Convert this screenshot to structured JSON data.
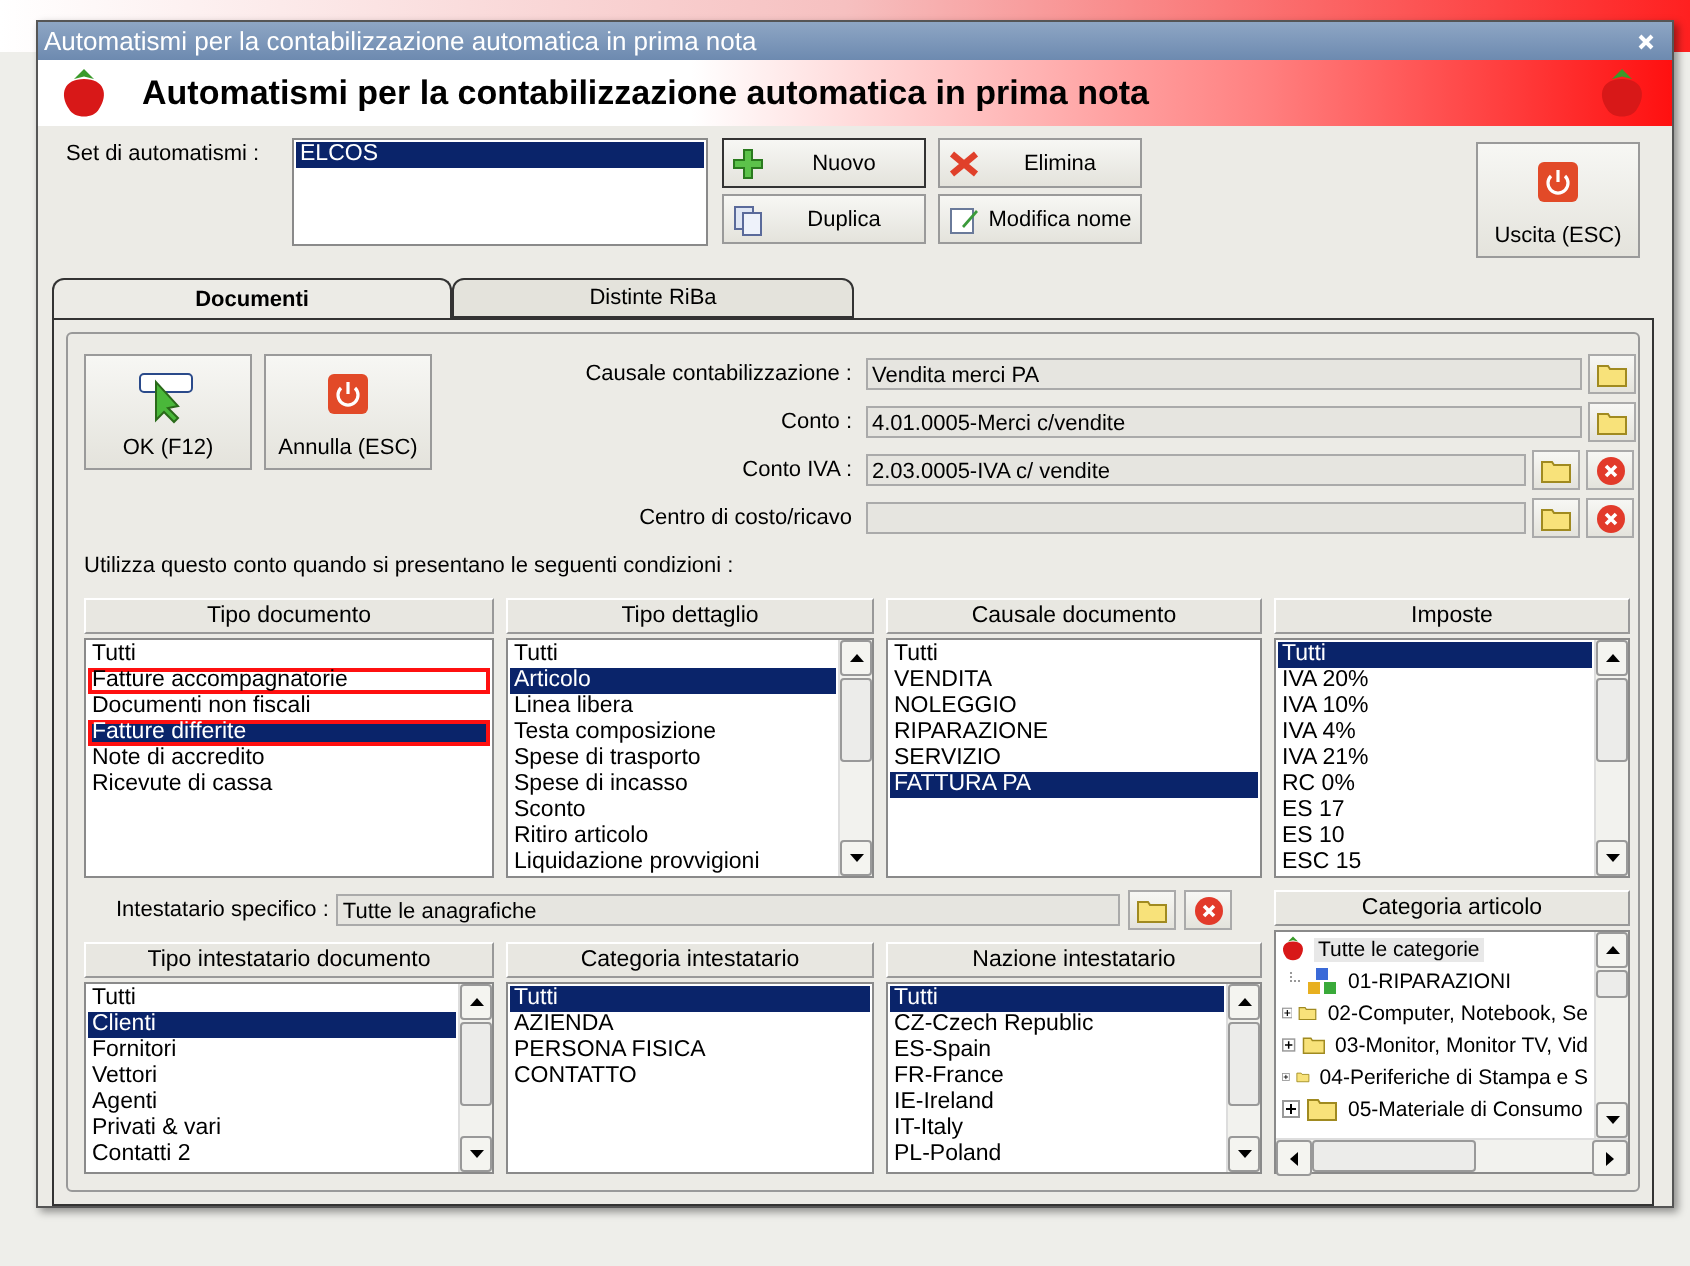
{
  "dialog": {
    "title": "Automatismi per la contabilizzazione automatica in prima nota"
  },
  "header": {
    "title": "Automatismi per la contabilizzazione automatica in prima nota"
  },
  "set": {
    "label": "Set di automatismi :",
    "items": [
      {
        "text": "ELCOS",
        "selected": true
      }
    ]
  },
  "actions": [
    {
      "label": "Nuovo",
      "kind": "add"
    },
    {
      "label": "Elimina",
      "kind": "delete"
    },
    {
      "label": "Duplica",
      "kind": "copy"
    },
    {
      "label": "Modifica nome",
      "kind": "rename"
    }
  ],
  "exit_button": "Uscita (ESC)",
  "tabs": [
    {
      "label": "Documenti",
      "selected": true
    },
    {
      "label": "Distinte RiBa",
      "selected": false
    }
  ],
  "ok_button": "OK (F12)",
  "cancel_button": "Annulla (ESC)",
  "fields": [
    {
      "label": "Causale contabilizzazione :",
      "value": "Vendita merci PA",
      "kind": "pick"
    },
    {
      "label": "Conto :",
      "value": "4.01.0005-Merci c/vendite",
      "kind": "pick"
    },
    {
      "label": "Conto IVA :",
      "value": "2.03.0005-IVA c/ vendite",
      "kind": "pick_clear"
    },
    {
      "label": "Centro di costo/ricavo",
      "kind": "pick_clear"
    }
  ],
  "conditions_label": "Utilizza questo conto quando si presentano le seguenti condizioni :",
  "lists": [
    {
      "title": "Tipo documento",
      "scrollbar": false,
      "items": [
        {
          "text": "Tutti",
          "selected": false,
          "highlighted": false
        },
        {
          "text": "Fatture accompagnatorie",
          "selected": false,
          "highlighted": true
        },
        {
          "text": "Documenti non fiscali",
          "selected": false,
          "highlighted": false
        },
        {
          "text": "Fatture differite",
          "selected": true,
          "highlighted": true
        },
        {
          "text": "Note di accredito",
          "selected": false,
          "highlighted": false
        },
        {
          "text": "Ricevute di cassa",
          "selected": false,
          "highlighted": false
        }
      ]
    },
    {
      "title": "Tipo dettaglio",
      "scrollbar": true,
      "items": [
        {
          "text": "Tutti",
          "selected": false,
          "highlighted": false
        },
        {
          "text": "Articolo",
          "selected": true,
          "highlighted": false
        },
        {
          "text": "Linea libera",
          "selected": false,
          "highlighted": false
        },
        {
          "text": "Testa composizione",
          "selected": false,
          "highlighted": false
        },
        {
          "text": "Spese di trasporto",
          "selected": false,
          "highlighted": false
        },
        {
          "text": "Spese di incasso",
          "selected": false,
          "highlighted": false
        },
        {
          "text": "Sconto",
          "selected": false,
          "highlighted": false
        },
        {
          "text": "Ritiro articolo",
          "selected": false,
          "highlighted": false
        },
        {
          "text": "Liquidazione provvigioni",
          "selected": false,
          "highlighted": false
        }
      ]
    },
    {
      "title": "Causale documento",
      "scrollbar": false,
      "items": [
        {
          "text": "Tutti",
          "selected": false,
          "highlighted": false
        },
        {
          "text": "VENDITA",
          "selected": false,
          "highlighted": false
        },
        {
          "text": "NOLEGGIO",
          "selected": false,
          "highlighted": false
        },
        {
          "text": "RIPARAZIONE",
          "selected": false,
          "highlighted": false
        },
        {
          "text": "SERVIZIO",
          "selected": false,
          "highlighted": false
        },
        {
          "text": "FATTURA PA",
          "selected": true,
          "highlighted": false
        }
      ]
    },
    {
      "title": "Imposte",
      "scrollbar": true,
      "items": [
        {
          "text": "Tutti",
          "selected": true,
          "highlighted": false
        },
        {
          "text": "IVA 20%",
          "selected": false,
          "highlighted": false
        },
        {
          "text": "IVA 10%",
          "selected": false,
          "highlighted": false
        },
        {
          "text": "IVA 4%",
          "selected": false,
          "highlighted": false
        },
        {
          "text": "IVA 21%",
          "selected": false,
          "highlighted": false
        },
        {
          "text": "RC 0%",
          "selected": false,
          "highlighted": false
        },
        {
          "text": "ES 17",
          "selected": false,
          "highlighted": false
        },
        {
          "text": "ES 10",
          "selected": false,
          "highlighted": false
        },
        {
          "text": "ESC 15",
          "selected": false,
          "highlighted": false
        }
      ]
    }
  ],
  "owner": {
    "label": "Intestatario specifico :",
    "value": "Tutte le anagrafiche"
  },
  "owner_lists": [
    {
      "title": "Tipo intestatario documento",
      "scrollbar": true,
      "items": [
        {
          "text": "Tutti",
          "selected": false,
          "highlighted": false
        },
        {
          "text": "Clienti",
          "selected": true,
          "highlighted": false
        },
        {
          "text": "Fornitori",
          "selected": false,
          "highlighted": false
        },
        {
          "text": "Vettori",
          "selected": false,
          "highlighted": false
        },
        {
          "text": "Agenti",
          "selected": false,
          "highlighted": false
        },
        {
          "text": "Privati & vari",
          "selected": false,
          "highlighted": false
        },
        {
          "text": "Contatti 2",
          "selected": false,
          "highlighted": false
        }
      ]
    },
    {
      "title": "Categoria intestatario",
      "scrollbar": false,
      "items": [
        {
          "text": "Tutti",
          "selected": true,
          "highlighted": false
        },
        {
          "text": "AZIENDA",
          "selected": false,
          "highlighted": false
        },
        {
          "text": "PERSONA FISICA",
          "selected": false,
          "highlighted": false
        },
        {
          "text": "CONTATTO",
          "selected": false,
          "highlighted": false
        }
      ]
    },
    {
      "title": "Nazione intestatario",
      "scrollbar": true,
      "items": [
        {
          "text": "Tutti",
          "selected": true,
          "highlighted": false
        },
        {
          "text": "CZ-Czech Republic",
          "selected": false,
          "highlighted": false
        },
        {
          "text": "ES-Spain",
          "selected": false,
          "highlighted": false
        },
        {
          "text": "FR-France",
          "selected": false,
          "highlighted": false
        },
        {
          "text": "IE-Ireland",
          "selected": false,
          "highlighted": false
        },
        {
          "text": "IT-Italy",
          "selected": false,
          "highlighted": false
        },
        {
          "text": "PL-Poland",
          "selected": false,
          "highlighted": false
        }
      ]
    }
  ],
  "category_tree": {
    "title": "Categoria articolo",
    "root": {
      "text": "Tutte le categorie",
      "selected": true
    },
    "items": [
      {
        "text": "01-RIPARAZIONI",
        "kind": "group",
        "expandable": false
      },
      {
        "text": "02-Computer, Notebook, Se",
        "kind": "folder",
        "expandable": true
      },
      {
        "text": "03-Monitor, Monitor TV, Vid",
        "kind": "folder",
        "expandable": true
      },
      {
        "text": "04-Periferiche di Stampa e S",
        "kind": "folder",
        "expandable": true
      },
      {
        "text": "05-Materiale di Consumo",
        "kind": "folder",
        "expandable": true
      }
    ]
  }
}
